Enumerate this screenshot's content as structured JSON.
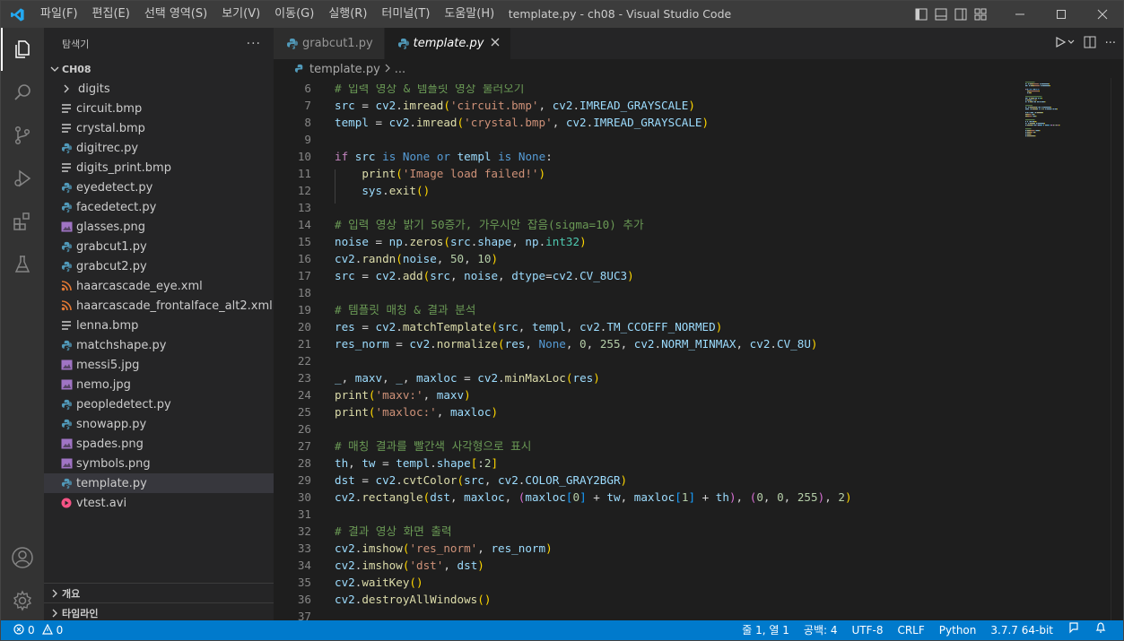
{
  "titlebar": {
    "menu": [
      "파일(F)",
      "편집(E)",
      "선택 영역(S)",
      "보기(V)",
      "이동(G)",
      "실행(R)",
      "터미널(T)",
      "도움말(H)"
    ],
    "window_title": "template.py - ch08 - Visual Studio Code"
  },
  "sidebar": {
    "title": "탐색기",
    "more": "···",
    "root": "CH08",
    "items": [
      {
        "label": "digits",
        "kind": "folder"
      },
      {
        "label": "circuit.bmp",
        "kind": "image-lines"
      },
      {
        "label": "crystal.bmp",
        "kind": "image-lines"
      },
      {
        "label": "digitrec.py",
        "kind": "python"
      },
      {
        "label": "digits_print.bmp",
        "kind": "image-lines"
      },
      {
        "label": "eyedetect.py",
        "kind": "python"
      },
      {
        "label": "facedetect.py",
        "kind": "python"
      },
      {
        "label": "glasses.png",
        "kind": "image"
      },
      {
        "label": "grabcut1.py",
        "kind": "python"
      },
      {
        "label": "grabcut2.py",
        "kind": "python"
      },
      {
        "label": "haarcascade_eye.xml",
        "kind": "rss"
      },
      {
        "label": "haarcascade_frontalface_alt2.xml",
        "kind": "rss"
      },
      {
        "label": "lenna.bmp",
        "kind": "image-lines"
      },
      {
        "label": "matchshape.py",
        "kind": "python"
      },
      {
        "label": "messi5.jpg",
        "kind": "image"
      },
      {
        "label": "nemo.jpg",
        "kind": "image"
      },
      {
        "label": "peopledetect.py",
        "kind": "python"
      },
      {
        "label": "snowapp.py",
        "kind": "python"
      },
      {
        "label": "spades.png",
        "kind": "image"
      },
      {
        "label": "symbols.png",
        "kind": "image"
      },
      {
        "label": "template.py",
        "kind": "python",
        "selected": true
      },
      {
        "label": "vtest.avi",
        "kind": "video"
      }
    ],
    "outline": "개요",
    "timeline": "타임라인"
  },
  "editor": {
    "tabs": [
      {
        "label": "grabcut1.py",
        "active": false
      },
      {
        "label": "template.py",
        "active": true
      }
    ],
    "breadcrumb": {
      "file": "template.py",
      "rest": "..."
    },
    "lines": [
      {
        "n": "6",
        "tokens": [
          [
            "c",
            "# 입력 영상 & 템플릿 영상 불러오기"
          ]
        ]
      },
      {
        "n": "7",
        "tokens": [
          [
            "v",
            "src"
          ],
          [
            "p",
            " = "
          ],
          [
            "v",
            "cv2"
          ],
          [
            "p",
            "."
          ],
          [
            "f",
            "imread"
          ],
          [
            "br",
            "("
          ],
          [
            "s",
            "'circuit.bmp'"
          ],
          [
            "p",
            ", "
          ],
          [
            "v",
            "cv2"
          ],
          [
            "p",
            "."
          ],
          [
            "v",
            "IMREAD_GRAYSCALE"
          ],
          [
            "br",
            ")"
          ]
        ]
      },
      {
        "n": "8",
        "tokens": [
          [
            "v",
            "templ"
          ],
          [
            "p",
            " = "
          ],
          [
            "v",
            "cv2"
          ],
          [
            "p",
            "."
          ],
          [
            "f",
            "imread"
          ],
          [
            "br",
            "("
          ],
          [
            "s",
            "'crystal.bmp'"
          ],
          [
            "p",
            ", "
          ],
          [
            "v",
            "cv2"
          ],
          [
            "p",
            "."
          ],
          [
            "v",
            "IMREAD_GRAYSCALE"
          ],
          [
            "br",
            ")"
          ]
        ]
      },
      {
        "n": "9",
        "tokens": []
      },
      {
        "n": "10",
        "tokens": [
          [
            "k",
            "if"
          ],
          [
            "p",
            " "
          ],
          [
            "v",
            "src"
          ],
          [
            "p",
            " "
          ],
          [
            "b",
            "is"
          ],
          [
            "p",
            " "
          ],
          [
            "b",
            "None"
          ],
          [
            "p",
            " "
          ],
          [
            "b",
            "or"
          ],
          [
            "p",
            " "
          ],
          [
            "v",
            "templ"
          ],
          [
            "p",
            " "
          ],
          [
            "b",
            "is"
          ],
          [
            "p",
            " "
          ],
          [
            "b",
            "None"
          ],
          [
            "p",
            ":"
          ]
        ]
      },
      {
        "n": "11",
        "tokens": [
          [
            "p",
            "    "
          ],
          [
            "f",
            "print"
          ],
          [
            "br",
            "("
          ],
          [
            "s",
            "'Image load failed!'"
          ],
          [
            "br",
            ")"
          ]
        ]
      },
      {
        "n": "12",
        "tokens": [
          [
            "p",
            "    "
          ],
          [
            "v",
            "sys"
          ],
          [
            "p",
            "."
          ],
          [
            "f",
            "exit"
          ],
          [
            "br",
            "()"
          ]
        ]
      },
      {
        "n": "13",
        "tokens": []
      },
      {
        "n": "14",
        "tokens": [
          [
            "c",
            "# 입력 영상 밝기 50증가, 가우시안 잡음(sigma=10) 추가"
          ]
        ]
      },
      {
        "n": "15",
        "tokens": [
          [
            "v",
            "noise"
          ],
          [
            "p",
            " = "
          ],
          [
            "v",
            "np"
          ],
          [
            "p",
            "."
          ],
          [
            "f",
            "zeros"
          ],
          [
            "br",
            "("
          ],
          [
            "v",
            "src"
          ],
          [
            "p",
            "."
          ],
          [
            "v",
            "shape"
          ],
          [
            "p",
            ", "
          ],
          [
            "v",
            "np"
          ],
          [
            "p",
            "."
          ],
          [
            "cls",
            "int32"
          ],
          [
            "br",
            ")"
          ]
        ]
      },
      {
        "n": "16",
        "tokens": [
          [
            "v",
            "cv2"
          ],
          [
            "p",
            "."
          ],
          [
            "f",
            "randn"
          ],
          [
            "br",
            "("
          ],
          [
            "v",
            "noise"
          ],
          [
            "p",
            ", "
          ],
          [
            "n",
            "50"
          ],
          [
            "p",
            ", "
          ],
          [
            "n",
            "10"
          ],
          [
            "br",
            ")"
          ]
        ]
      },
      {
        "n": "17",
        "tokens": [
          [
            "v",
            "src"
          ],
          [
            "p",
            " = "
          ],
          [
            "v",
            "cv2"
          ],
          [
            "p",
            "."
          ],
          [
            "f",
            "add"
          ],
          [
            "br",
            "("
          ],
          [
            "v",
            "src"
          ],
          [
            "p",
            ", "
          ],
          [
            "v",
            "noise"
          ],
          [
            "p",
            ", "
          ],
          [
            "v",
            "dtype"
          ],
          [
            "p",
            "="
          ],
          [
            "v",
            "cv2"
          ],
          [
            "p",
            "."
          ],
          [
            "v",
            "CV_8UC3"
          ],
          [
            "br",
            ")"
          ]
        ]
      },
      {
        "n": "18",
        "tokens": []
      },
      {
        "n": "19",
        "tokens": [
          [
            "c",
            "# 템플릿 매칭 & 결과 분석"
          ]
        ]
      },
      {
        "n": "20",
        "tokens": [
          [
            "v",
            "res"
          ],
          [
            "p",
            " = "
          ],
          [
            "v",
            "cv2"
          ],
          [
            "p",
            "."
          ],
          [
            "f",
            "matchTemplate"
          ],
          [
            "br",
            "("
          ],
          [
            "v",
            "src"
          ],
          [
            "p",
            ", "
          ],
          [
            "v",
            "templ"
          ],
          [
            "p",
            ", "
          ],
          [
            "v",
            "cv2"
          ],
          [
            "p",
            "."
          ],
          [
            "v",
            "TM_CCOEFF_NORMED"
          ],
          [
            "br",
            ")"
          ]
        ]
      },
      {
        "n": "21",
        "tokens": [
          [
            "v",
            "res_norm"
          ],
          [
            "p",
            " = "
          ],
          [
            "v",
            "cv2"
          ],
          [
            "p",
            "."
          ],
          [
            "f",
            "normalize"
          ],
          [
            "br",
            "("
          ],
          [
            "v",
            "res"
          ],
          [
            "p",
            ", "
          ],
          [
            "b",
            "None"
          ],
          [
            "p",
            ", "
          ],
          [
            "n",
            "0"
          ],
          [
            "p",
            ", "
          ],
          [
            "n",
            "255"
          ],
          [
            "p",
            ", "
          ],
          [
            "v",
            "cv2"
          ],
          [
            "p",
            "."
          ],
          [
            "v",
            "NORM_MINMAX"
          ],
          [
            "p",
            ", "
          ],
          [
            "v",
            "cv2"
          ],
          [
            "p",
            "."
          ],
          [
            "v",
            "CV_8U"
          ],
          [
            "br",
            ")"
          ]
        ]
      },
      {
        "n": "22",
        "tokens": []
      },
      {
        "n": "23",
        "tokens": [
          [
            "v",
            "_"
          ],
          [
            "p",
            ", "
          ],
          [
            "v",
            "maxv"
          ],
          [
            "p",
            ", "
          ],
          [
            "v",
            "_"
          ],
          [
            "p",
            ", "
          ],
          [
            "v",
            "maxloc"
          ],
          [
            "p",
            " = "
          ],
          [
            "v",
            "cv2"
          ],
          [
            "p",
            "."
          ],
          [
            "f",
            "minMaxLoc"
          ],
          [
            "br",
            "("
          ],
          [
            "v",
            "res"
          ],
          [
            "br",
            ")"
          ]
        ]
      },
      {
        "n": "24",
        "tokens": [
          [
            "f",
            "print"
          ],
          [
            "br",
            "("
          ],
          [
            "s",
            "'maxv:'"
          ],
          [
            "p",
            ", "
          ],
          [
            "v",
            "maxv"
          ],
          [
            "br",
            ")"
          ]
        ]
      },
      {
        "n": "25",
        "tokens": [
          [
            "f",
            "print"
          ],
          [
            "br",
            "("
          ],
          [
            "s",
            "'maxloc:'"
          ],
          [
            "p",
            ", "
          ],
          [
            "v",
            "maxloc"
          ],
          [
            "br",
            ")"
          ]
        ]
      },
      {
        "n": "26",
        "tokens": []
      },
      {
        "n": "27",
        "tokens": [
          [
            "c",
            "# 매칭 결과를 빨간색 사각형으로 표시"
          ]
        ]
      },
      {
        "n": "28",
        "tokens": [
          [
            "v",
            "th"
          ],
          [
            "p",
            ", "
          ],
          [
            "v",
            "tw"
          ],
          [
            "p",
            " = "
          ],
          [
            "v",
            "templ"
          ],
          [
            "p",
            "."
          ],
          [
            "v",
            "shape"
          ],
          [
            "br",
            "["
          ],
          [
            "p",
            ":"
          ],
          [
            "n",
            "2"
          ],
          [
            "br",
            "]"
          ]
        ]
      },
      {
        "n": "29",
        "tokens": [
          [
            "v",
            "dst"
          ],
          [
            "p",
            " = "
          ],
          [
            "v",
            "cv2"
          ],
          [
            "p",
            "."
          ],
          [
            "f",
            "cvtColor"
          ],
          [
            "br",
            "("
          ],
          [
            "v",
            "src"
          ],
          [
            "p",
            ", "
          ],
          [
            "v",
            "cv2"
          ],
          [
            "p",
            "."
          ],
          [
            "v",
            "COLOR_GRAY2BGR"
          ],
          [
            "br",
            ")"
          ]
        ]
      },
      {
        "n": "30",
        "tokens": [
          [
            "v",
            "cv2"
          ],
          [
            "p",
            "."
          ],
          [
            "f",
            "rectangle"
          ],
          [
            "br",
            "("
          ],
          [
            "v",
            "dst"
          ],
          [
            "p",
            ", "
          ],
          [
            "v",
            "maxloc"
          ],
          [
            "p",
            ", "
          ],
          [
            "br2",
            "("
          ],
          [
            "v",
            "maxloc"
          ],
          [
            "br3",
            "["
          ],
          [
            "n",
            "0"
          ],
          [
            "br3",
            "]"
          ],
          [
            "p",
            " + "
          ],
          [
            "v",
            "tw"
          ],
          [
            "p",
            ", "
          ],
          [
            "v",
            "maxloc"
          ],
          [
            "br3",
            "["
          ],
          [
            "n",
            "1"
          ],
          [
            "br3",
            "]"
          ],
          [
            "p",
            " + "
          ],
          [
            "v",
            "th"
          ],
          [
            "br2",
            ")"
          ],
          [
            "p",
            ", "
          ],
          [
            "br2",
            "("
          ],
          [
            "n",
            "0"
          ],
          [
            "p",
            ", "
          ],
          [
            "n",
            "0"
          ],
          [
            "p",
            ", "
          ],
          [
            "n",
            "255"
          ],
          [
            "br2",
            ")"
          ],
          [
            "p",
            ", "
          ],
          [
            "n",
            "2"
          ],
          [
            "br",
            ")"
          ]
        ]
      },
      {
        "n": "31",
        "tokens": []
      },
      {
        "n": "32",
        "tokens": [
          [
            "c",
            "# 결과 영상 화면 출력"
          ]
        ]
      },
      {
        "n": "33",
        "tokens": [
          [
            "v",
            "cv2"
          ],
          [
            "p",
            "."
          ],
          [
            "f",
            "imshow"
          ],
          [
            "br",
            "("
          ],
          [
            "s",
            "'res_norm'"
          ],
          [
            "p",
            ", "
          ],
          [
            "v",
            "res_norm"
          ],
          [
            "br",
            ")"
          ]
        ]
      },
      {
        "n": "34",
        "tokens": [
          [
            "v",
            "cv2"
          ],
          [
            "p",
            "."
          ],
          [
            "f",
            "imshow"
          ],
          [
            "br",
            "("
          ],
          [
            "s",
            "'dst'"
          ],
          [
            "p",
            ", "
          ],
          [
            "v",
            "dst"
          ],
          [
            "br",
            ")"
          ]
        ]
      },
      {
        "n": "35",
        "tokens": [
          [
            "v",
            "cv2"
          ],
          [
            "p",
            "."
          ],
          [
            "f",
            "waitKey"
          ],
          [
            "br",
            "()"
          ]
        ]
      },
      {
        "n": "36",
        "tokens": [
          [
            "v",
            "cv2"
          ],
          [
            "p",
            "."
          ],
          [
            "f",
            "destroyAllWindows"
          ],
          [
            "br",
            "()"
          ]
        ]
      },
      {
        "n": "37",
        "tokens": []
      }
    ]
  },
  "statusbar": {
    "errors": "0",
    "warnings": "0",
    "position": "줄 1, 열 1",
    "spaces": "공백: 4",
    "encoding": "UTF-8",
    "eol": "CRLF",
    "language": "Python",
    "interpreter": "3.7.7 64-bit"
  },
  "colors": {
    "accent": "#007acc",
    "python_icon": "#519aba",
    "image_icon": "#a074c4",
    "rss_icon": "#e37933",
    "video_icon": "#f55385"
  }
}
